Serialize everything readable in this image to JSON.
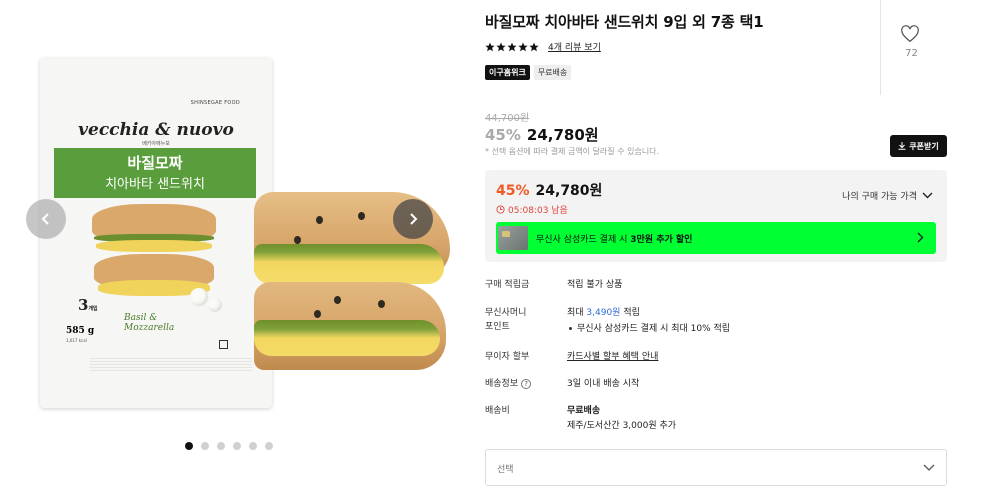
{
  "gallery": {
    "package": {
      "maker": "SHINSEGAE FOOD",
      "brand": "vecchia & nuovo",
      "brand_ko": "베키아에누보",
      "name_line1": "바질모짜",
      "name_line2": "치아바타 샌드위치",
      "count": "3",
      "count_unit": "개입",
      "weight": "585 g",
      "kcal": "1,617 kcal",
      "flavor_line1": "Basil &",
      "flavor_line2": "Mozzarella"
    },
    "prev_icon": "chevron-left-icon",
    "next_icon": "chevron-right-icon",
    "dots_total": 6,
    "active_dot": 0
  },
  "product": {
    "title": "바질모짜 치아바타 샌드위치 9입 외 7종 택1",
    "rating_stars": 5,
    "review_link": "4개 리뷰 보기",
    "tags": [
      "이구홈위크",
      "무료배송"
    ],
    "like_count": "72",
    "original_price": "44,700원",
    "discount_pct": "45%",
    "price": "24,780원",
    "price_note": "* 선택 옵션에 따라 결제 금액이 달라질 수 있습니다.",
    "coupon_label": "쿠폰받기"
  },
  "my_price_box": {
    "discount_pct": "45%",
    "price": "24,780원",
    "timer": "05:08:03 남음",
    "my_price_label": "나의 구매 가능 가격",
    "banner_text_prefix": "무신사 삼성카드 결제 시 ",
    "banner_text_bold": "3만원 추가 할인",
    "accent_color": "#f15a24",
    "banner_color": "#00ff33"
  },
  "info": {
    "points_label": "구매 적립금",
    "points_value": "적립 불가 상품",
    "money_label1": "무신사머니",
    "money_label2": "포인트",
    "money_prefix": "최대 ",
    "money_amount": "3,490원",
    "money_suffix": " 적립",
    "money_bullet": "무신사 삼성카드 결제 시 최대 10% 적립",
    "installment_label": "무이자 할부",
    "installment_value": "카드사별 할부 혜택 안내",
    "delivery_label": "배송정보",
    "delivery_value": "3일 이내 배송 시작",
    "fee_label": "배송비",
    "fee_value": "무료배송",
    "fee_extra": "제주/도서산간 3,000원 추가"
  },
  "option_select": {
    "placeholder": "선택"
  }
}
